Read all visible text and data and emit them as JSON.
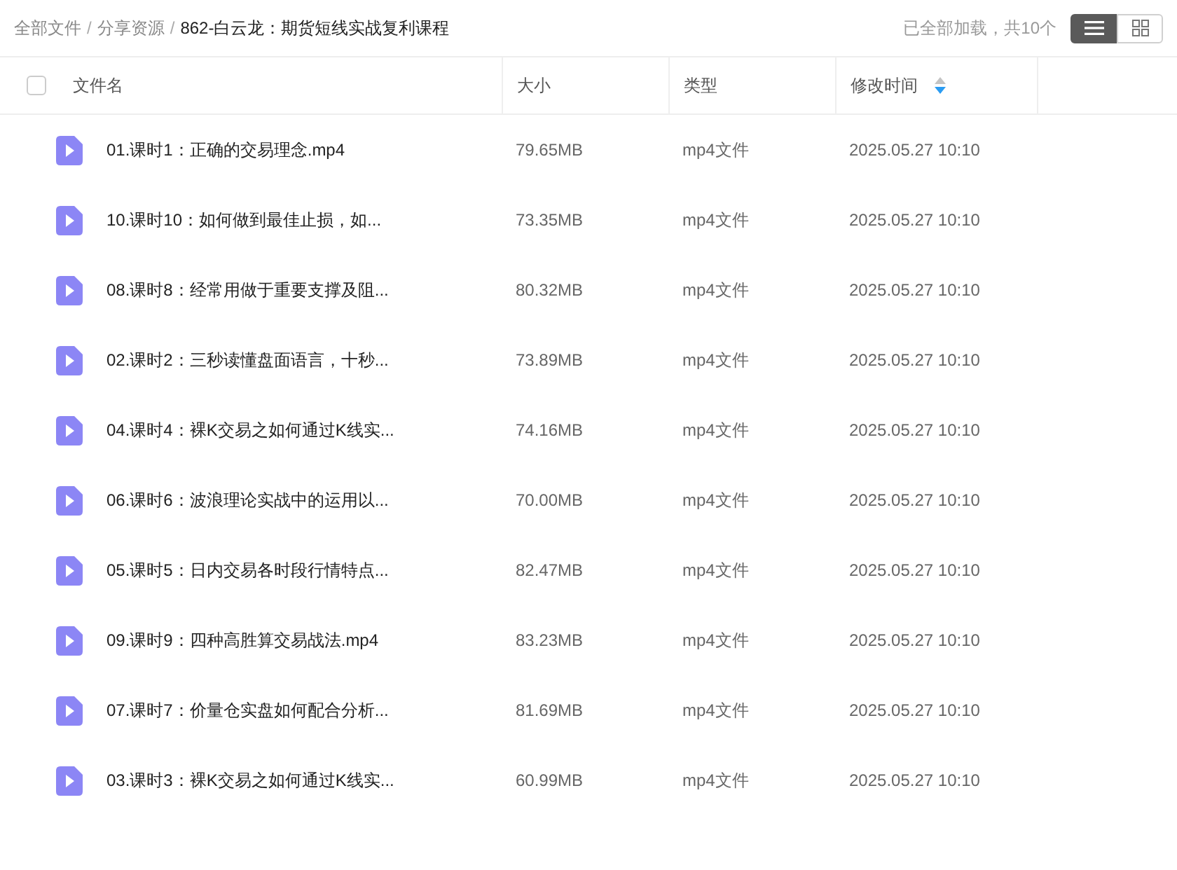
{
  "breadcrumb": [
    {
      "label": "全部文件",
      "current": false
    },
    {
      "label": "分享资源",
      "current": false
    },
    {
      "label": "862-白云龙：期货短线实战复利课程",
      "current": true
    }
  ],
  "breadcrumb_separator": "/",
  "load_status": "已全部加载，共10个",
  "view_modes": [
    {
      "kind": "list",
      "selected": true
    },
    {
      "kind": "grid",
      "selected": false
    }
  ],
  "table": {
    "select_all": {
      "checked": false
    },
    "columns": [
      {
        "label": "文件名",
        "sorted": false
      },
      {
        "label": "大小",
        "sorted": false
      },
      {
        "label": "类型",
        "sorted": false
      },
      {
        "label": "修改时间",
        "sorted": true,
        "descending": true
      }
    ],
    "rows": [
      {
        "name": "01.课时1：正确的交易理念.mp4",
        "size": "79.65MB",
        "type": "mp4文件",
        "modified": "2025.05.27 10:10"
      },
      {
        "name": "10.课时10：如何做到最佳止损，如...",
        "size": "73.35MB",
        "type": "mp4文件",
        "modified": "2025.05.27 10:10"
      },
      {
        "name": "08.课时8：经常用做于重要支撑及阻...",
        "size": "80.32MB",
        "type": "mp4文件",
        "modified": "2025.05.27 10:10"
      },
      {
        "name": "02.课时2：三秒读懂盘面语言，十秒...",
        "size": "73.89MB",
        "type": "mp4文件",
        "modified": "2025.05.27 10:10"
      },
      {
        "name": "04.课时4：裸K交易之如何通过K线实...",
        "size": "74.16MB",
        "type": "mp4文件",
        "modified": "2025.05.27 10:10"
      },
      {
        "name": "06.课时6：波浪理论实战中的运用以...",
        "size": "70.00MB",
        "type": "mp4文件",
        "modified": "2025.05.27 10:10"
      },
      {
        "name": "05.课时5：日内交易各时段行情特点...",
        "size": "82.47MB",
        "type": "mp4文件",
        "modified": "2025.05.27 10:10"
      },
      {
        "name": "09.课时9：四种高胜算交易战法.mp4",
        "size": "83.23MB",
        "type": "mp4文件",
        "modified": "2025.05.27 10:10"
      },
      {
        "name": "07.课时7：价量仓实盘如何配合分析...",
        "size": "81.69MB",
        "type": "mp4文件",
        "modified": "2025.05.27 10:10"
      },
      {
        "name": "03.课时3：裸K交易之如何通过K线实...",
        "size": "60.99MB",
        "type": "mp4文件",
        "modified": "2025.05.27 10:10"
      }
    ]
  }
}
